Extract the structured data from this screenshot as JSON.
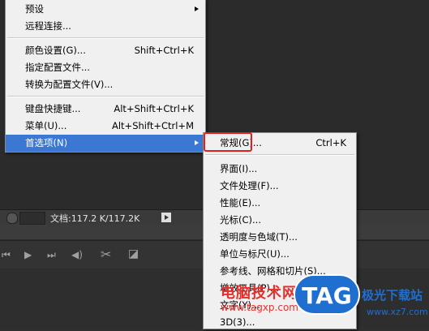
{
  "main_menu": {
    "items": [
      {
        "label": "预设",
        "shortcut": "",
        "submenu": true
      },
      {
        "label": "远程连接...",
        "shortcut": "",
        "submenu": false
      },
      {
        "label": "颜色设置(G)...",
        "shortcut": "Shift+Ctrl+K",
        "submenu": false
      },
      {
        "label": "指定配置文件...",
        "shortcut": "",
        "submenu": false
      },
      {
        "label": "转换为配置文件(V)...",
        "shortcut": "",
        "submenu": false
      },
      {
        "label": "键盘快捷键...",
        "shortcut": "Alt+Shift+Ctrl+K",
        "submenu": false
      },
      {
        "label": "菜单(U)...",
        "shortcut": "Alt+Shift+Ctrl+M",
        "submenu": false
      },
      {
        "label": "首选项(N)",
        "shortcut": "",
        "submenu": true
      }
    ]
  },
  "sub_menu": {
    "items": [
      {
        "label": "常规(G)...",
        "shortcut": "Ctrl+K"
      },
      {
        "label": "界面(I)...",
        "shortcut": ""
      },
      {
        "label": "文件处理(F)...",
        "shortcut": ""
      },
      {
        "label": "性能(E)...",
        "shortcut": ""
      },
      {
        "label": "光标(C)...",
        "shortcut": ""
      },
      {
        "label": "透明度与色域(T)...",
        "shortcut": ""
      },
      {
        "label": "单位与标尺(U)...",
        "shortcut": ""
      },
      {
        "label": "参考线、网格和切片(S)...",
        "shortcut": ""
      },
      {
        "label": "增效工具(P)...",
        "shortcut": ""
      },
      {
        "label": "文字(Y)...",
        "shortcut": ""
      },
      {
        "label": "3D(3)...",
        "shortcut": ""
      }
    ]
  },
  "status_bar": {
    "doc_info": "文档:117.2 K/117.2K"
  },
  "timeline": {
    "controls": [
      "⏮",
      "▶",
      "⏭",
      "◀)",
      "✂",
      "◪"
    ]
  },
  "watermark": {
    "text": "电脑技术网",
    "url": "www.tagxp.com",
    "tag": "TAG",
    "site": "极光下载站",
    "url2": "www.xz7.com"
  },
  "colors": {
    "highlight": "#3a78d4",
    "focus_box": "#e02020"
  }
}
